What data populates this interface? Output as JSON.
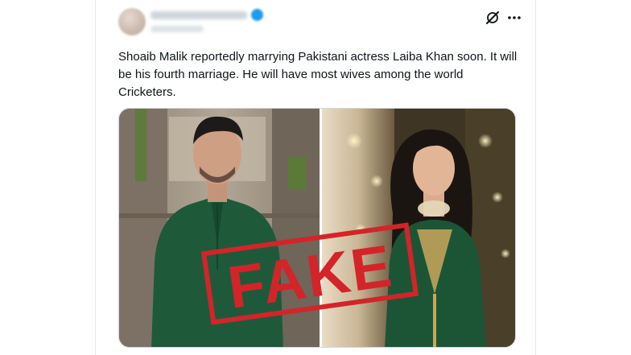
{
  "tweet": {
    "text": "Shoaib Malik reportedly marrying Pakistani actress Laiba Khan soon. It will be his fourth marriage. He will have most wives among the world Cricketers.",
    "header_icons": [
      "grok-icon",
      "more-icon"
    ],
    "more_glyph": "···",
    "media": {
      "photos": [
        "man-in-green-kurta-photo",
        "woman-in-green-embroidered-dress-photo"
      ],
      "stamp_text": "FAKE",
      "stamp_color": "#d3242a"
    }
  },
  "colors": {
    "text": "#0f1419",
    "border": "#cfd9de",
    "verified": "#1d9bf0",
    "outfit_green": "#1e5a3a"
  }
}
